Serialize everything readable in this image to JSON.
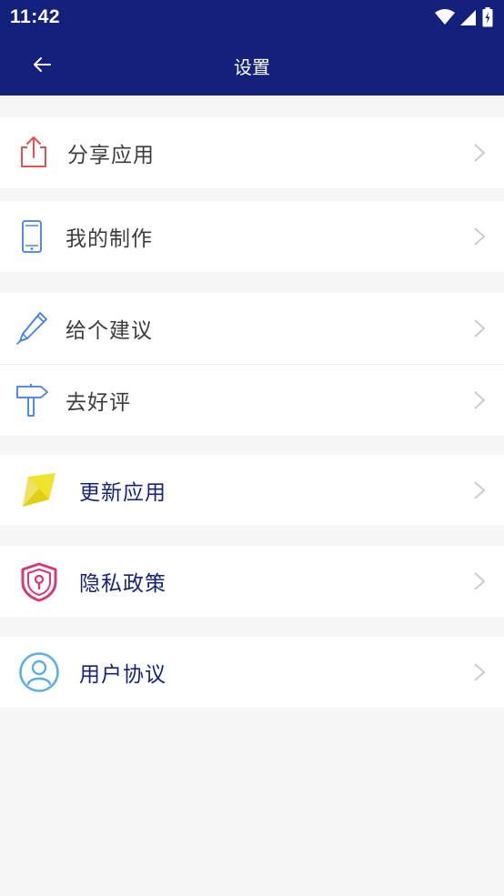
{
  "status_bar": {
    "time": "11:42",
    "icons": [
      "wifi-icon",
      "signal-icon",
      "battery-icon"
    ]
  },
  "app_bar": {
    "title": "设置",
    "back_icon": "arrow-left-icon"
  },
  "menu": {
    "share": {
      "label": "分享应用",
      "icon": "share-icon"
    },
    "my_works": {
      "label": "我的制作",
      "icon": "phone-icon"
    },
    "suggest": {
      "label": "给个建议",
      "icon": "pen-icon"
    },
    "rate": {
      "label": "去好评",
      "icon": "signpost-icon"
    },
    "update": {
      "label": "更新应用",
      "icon": "update-icon"
    },
    "privacy": {
      "label": "隐私政策",
      "icon": "shield-icon"
    },
    "agreement": {
      "label": "用户协议",
      "icon": "user-icon"
    }
  },
  "colors": {
    "header": "#14217c",
    "navy_text": "#17227d",
    "share_red": "#e8504f",
    "outline_blue": "#3f7fe0",
    "update_yellow": "#f1e22c",
    "privacy_pink": "#d9377b",
    "user_blue": "#5aaee9"
  }
}
